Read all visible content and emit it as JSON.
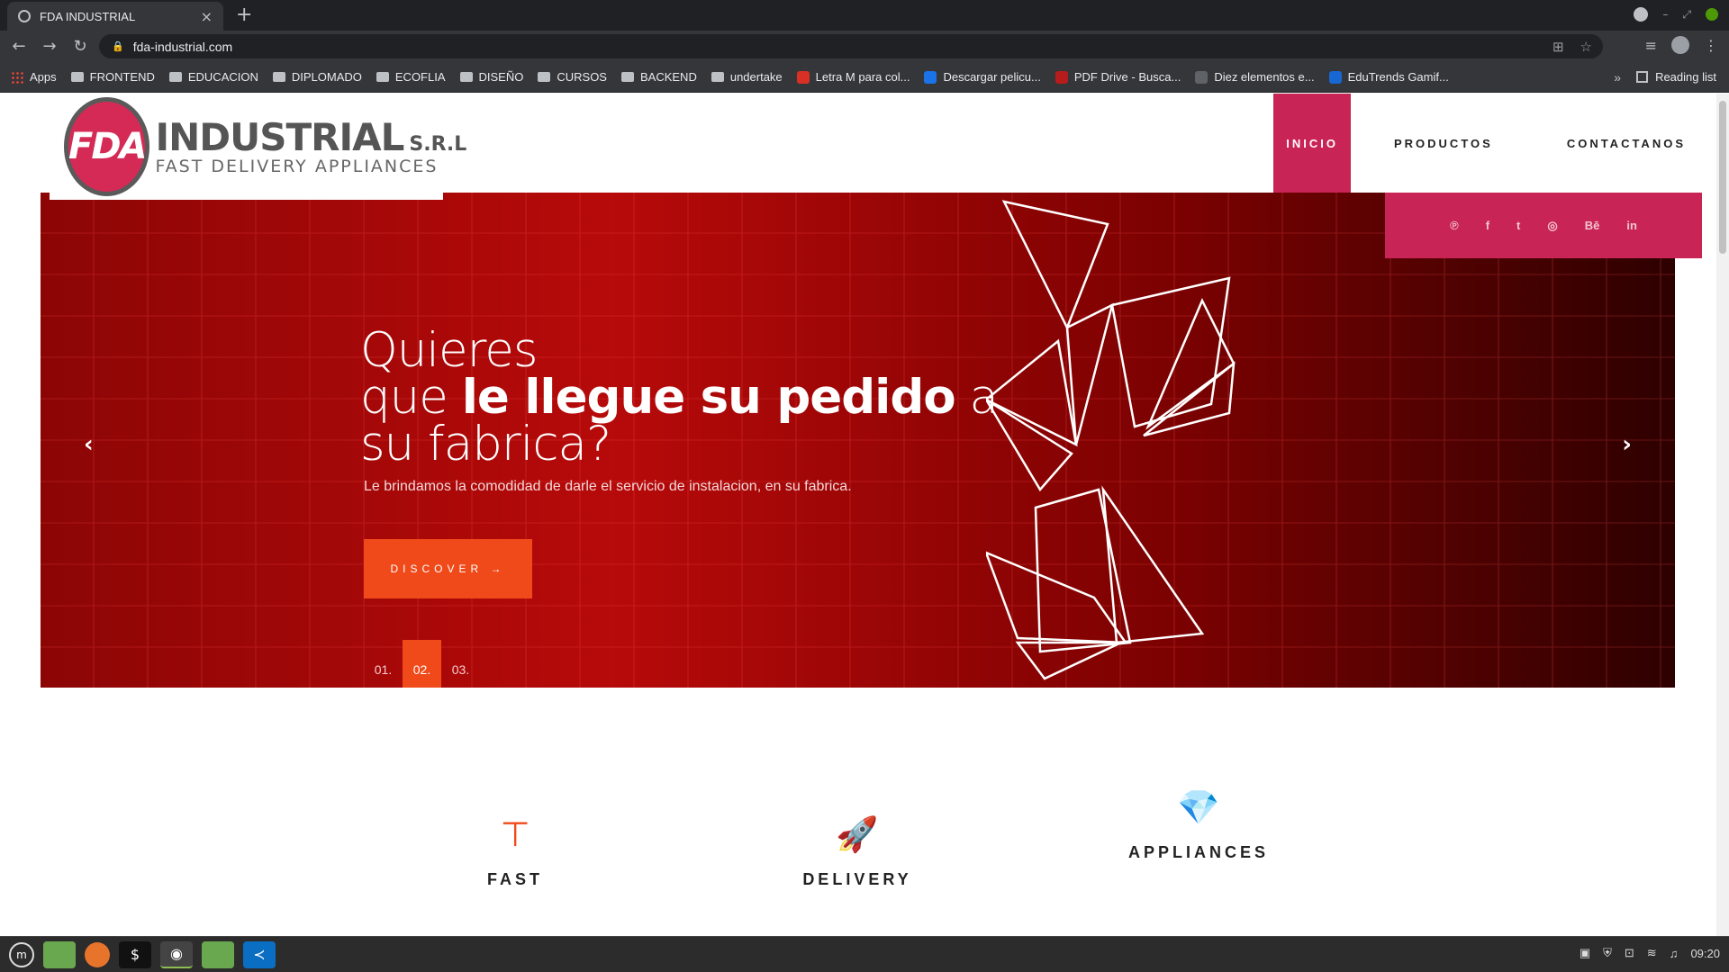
{
  "browser": {
    "tab_title": "FDA INDUSTRIAL",
    "url": "fda-industrial.com",
    "bookmarks": [
      {
        "label": "Apps",
        "icon": "apps-grid-icon"
      },
      {
        "label": "FRONTEND",
        "icon": "folder-icon"
      },
      {
        "label": "EDUCACION",
        "icon": "folder-icon"
      },
      {
        "label": "DIPLOMADO",
        "icon": "folder-icon"
      },
      {
        "label": "ECOFLIA",
        "icon": "folder-icon"
      },
      {
        "label": "DISEÑO",
        "icon": "folder-icon"
      },
      {
        "label": "CURSOS",
        "icon": "folder-icon"
      },
      {
        "label": "BACKEND",
        "icon": "folder-icon"
      },
      {
        "label": "undertake",
        "icon": "folder-icon"
      },
      {
        "label": "Letra M para col...",
        "icon": "site-icon"
      },
      {
        "label": "Descargar pelicu...",
        "icon": "site-icon"
      },
      {
        "label": "PDF Drive - Busca...",
        "icon": "site-icon"
      },
      {
        "label": "Diez elementos e...",
        "icon": "site-icon"
      },
      {
        "label": "EduTrends Gamif...",
        "icon": "site-icon"
      }
    ],
    "more": "»",
    "reading_list": "Reading list"
  },
  "site": {
    "logo": {
      "mark": "FDA",
      "name": "INDUSTRIAL",
      "suffix": "S.R.L",
      "tagline": "FAST DELIVERY APPLIANCES"
    },
    "nav": [
      "INICIO",
      "PRODUCTOS",
      "CONTACTANOS"
    ],
    "social": [
      "℗",
      "f",
      "t",
      "◎",
      "Bē",
      "in"
    ],
    "hero": {
      "line1": "Quieres",
      "line2_pre": "que ",
      "line2_bold": "le llegue su pedido",
      "line2_post": " a",
      "line3": "su fabrica?",
      "subtitle": "Le brindamos la comodidad de darle el servicio de instalacion, en su fabrica.",
      "button": "DISCOVER →",
      "pages": [
        "01.",
        "02.",
        "03."
      ],
      "active_page": "02."
    },
    "features": [
      {
        "label": "FAST",
        "icon": "t-shape-icon",
        "glyph": "⊤"
      },
      {
        "label": "DELIVERY",
        "icon": "rocket-icon",
        "glyph": "🚀"
      },
      {
        "label": "APPLIANCES",
        "icon": "diamond-hands-icon",
        "glyph": "💎"
      }
    ]
  },
  "taskbar": {
    "clock": "09:20"
  },
  "colors": {
    "brand": "#c92456",
    "accent": "#f04a1a",
    "hero": "#8e0808"
  }
}
